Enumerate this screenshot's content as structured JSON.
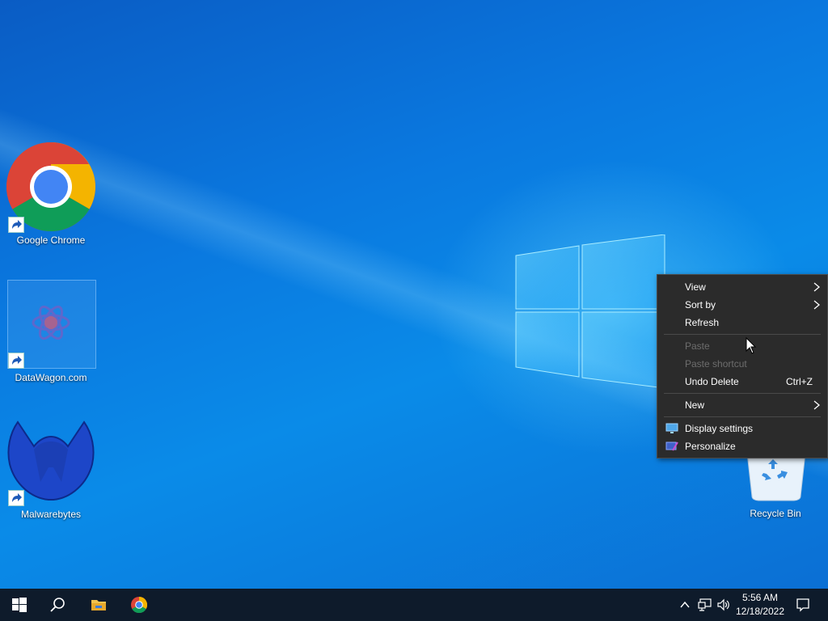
{
  "desktop": {
    "icons": [
      {
        "label": "Google Chrome",
        "icon": "chrome-icon"
      },
      {
        "label": "DataWagon.com",
        "icon": "datawagon-icon"
      },
      {
        "label": "Malwarebytes",
        "icon": "malwarebytes-icon"
      },
      {
        "label": "Recycle Bin",
        "icon": "recycle-bin-icon"
      }
    ]
  },
  "context_menu": {
    "view": "View",
    "sort_by": "Sort by",
    "refresh": "Refresh",
    "paste": "Paste",
    "paste_shortcut": "Paste shortcut",
    "undo_delete": "Undo Delete",
    "undo_shortcut": "Ctrl+Z",
    "new": "New",
    "display_settings": "Display settings",
    "personalize": "Personalize"
  },
  "taskbar": {
    "pinned": [
      "start-icon",
      "search-icon",
      "file-explorer-icon",
      "chrome-icon"
    ],
    "tray_icons": [
      "chevron-up-icon",
      "network-icon",
      "volume-icon",
      "notification-icon"
    ],
    "time": "5:56 AM",
    "date": "12/18/2022"
  },
  "colors": {
    "taskbar": "#0e1b2b",
    "menu_bg": "#2b2b2b",
    "wallpaper": "#0a78df"
  }
}
